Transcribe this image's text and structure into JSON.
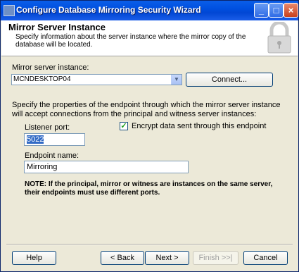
{
  "window": {
    "title": "Configure Database Mirroring Security Wizard"
  },
  "header": {
    "title": "Mirror Server Instance",
    "description": "Specify information about the server instance where the mirror copy of the database will be located."
  },
  "mirror": {
    "label": "Mirror server instance:",
    "value": "MCNDESKTOP04",
    "connect_label": "Connect..."
  },
  "endpoint": {
    "instructions": "Specify the properties of the endpoint through which the mirror server instance will accept connections from the principal and witness server instances:",
    "listener_label": "Listener port:",
    "listener_value": "5022",
    "encrypt_label": "Encrypt data sent through this endpoint",
    "encrypt_checked": true,
    "name_label": "Endpoint name:",
    "name_value": "Mirroring",
    "note": "NOTE: If the principal, mirror or witness are instances on the same server, their endpoints must use different ports."
  },
  "buttons": {
    "help": "Help",
    "back": "< Back",
    "next": "Next >",
    "finish": "Finish >>|",
    "cancel": "Cancel"
  },
  "icons": {
    "app": "wizard-app-icon",
    "header": "lock-icon",
    "dropdown": "chevron-down-icon",
    "check": "checkmark-icon"
  },
  "colors": {
    "titlebar": "#0050e0",
    "selection": "#316ac5",
    "dialog_bg": "#ece9d8"
  }
}
